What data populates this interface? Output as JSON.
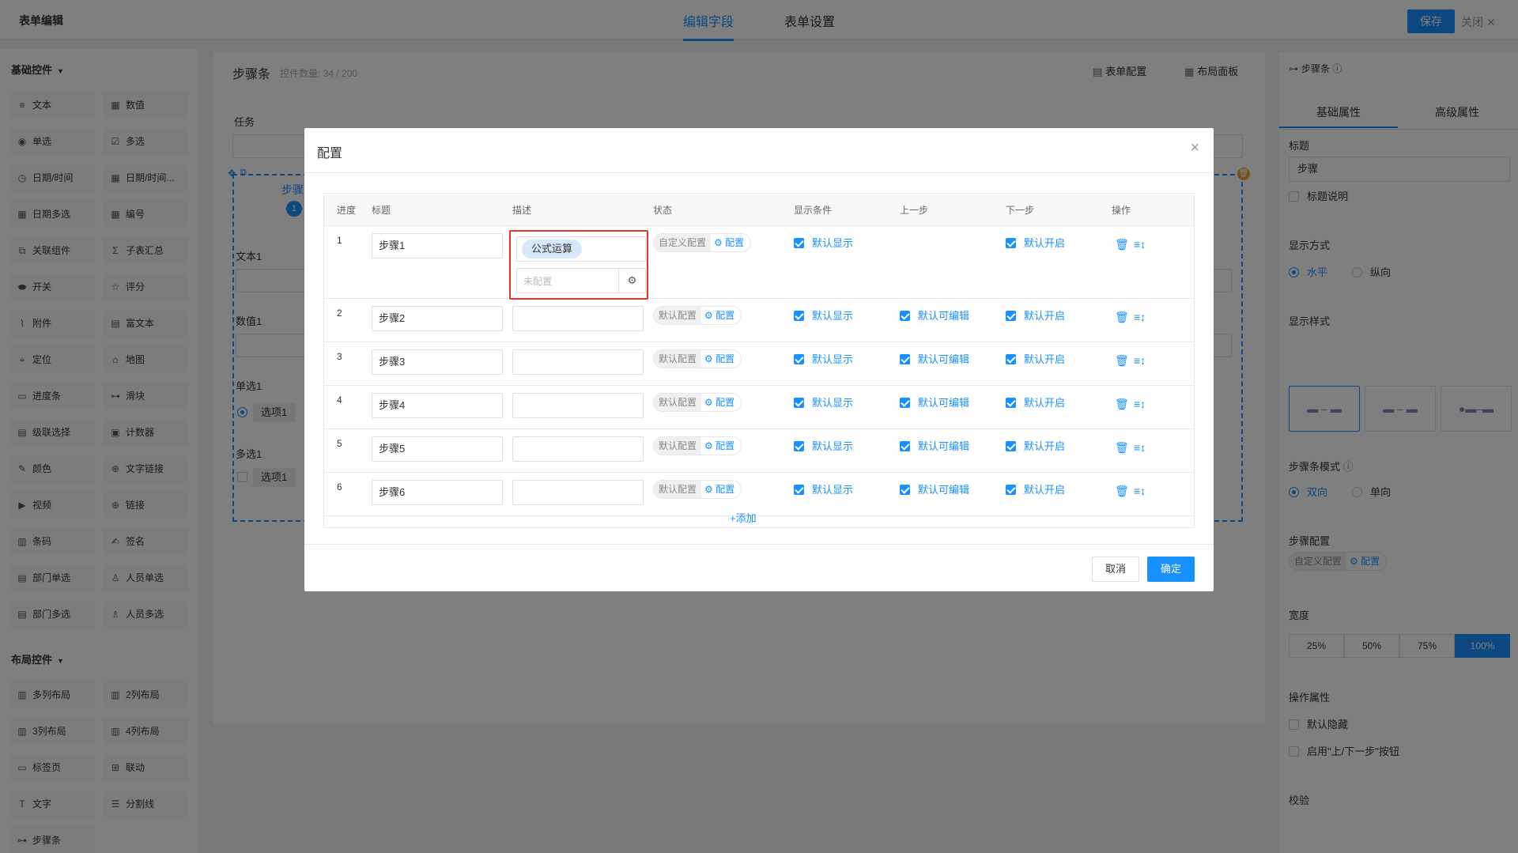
{
  "header": {
    "app_title": "表单编辑",
    "tabs": [
      {
        "label": "编辑字段"
      },
      {
        "label": "表单设置"
      }
    ],
    "save_label": "保存",
    "close_label": "关闭"
  },
  "left_panel": {
    "basic_title": "基础控件",
    "basic_items": [
      {
        "label": "文本",
        "icon": "text-icon"
      },
      {
        "label": "数值",
        "icon": "number-icon"
      },
      {
        "label": "单选",
        "icon": "radio-icon"
      },
      {
        "label": "多选",
        "icon": "checkbox-icon"
      },
      {
        "label": "日期/时间",
        "icon": "clock-icon"
      },
      {
        "label": "日期/时间...",
        "icon": "calendar-icon"
      },
      {
        "label": "日期多选",
        "icon": "calendar-icon"
      },
      {
        "label": "编号",
        "icon": "number-icon"
      },
      {
        "label": "关联组件",
        "icon": "link-icon"
      },
      {
        "label": "子表汇总",
        "icon": "sigma-icon"
      },
      {
        "label": "开关",
        "icon": "toggle-icon"
      },
      {
        "label": "评分",
        "icon": "star-icon"
      },
      {
        "label": "附件",
        "icon": "paperclip-icon"
      },
      {
        "label": "富文本",
        "icon": "richtext-icon"
      },
      {
        "label": "定位",
        "icon": "location-icon"
      },
      {
        "label": "地图",
        "icon": "map-icon"
      },
      {
        "label": "进度条",
        "icon": "progress-icon"
      },
      {
        "label": "滑块",
        "icon": "slider-icon"
      },
      {
        "label": "级联选择",
        "icon": "cascade-icon"
      },
      {
        "label": "计数器",
        "icon": "counter-icon"
      },
      {
        "label": "颜色",
        "icon": "color-icon"
      },
      {
        "label": "文字链接",
        "icon": "globe-icon"
      },
      {
        "label": "视频",
        "icon": "video-icon"
      },
      {
        "label": "链接",
        "icon": "globe-icon"
      },
      {
        "label": "条码",
        "icon": "barcode-icon"
      },
      {
        "label": "签名",
        "icon": "signature-icon"
      },
      {
        "label": "部门单选",
        "icon": "department-icon"
      },
      {
        "label": "人员单选",
        "icon": "user-icon"
      },
      {
        "label": "部门多选",
        "icon": "department-icon"
      },
      {
        "label": "人员多选",
        "icon": "users-icon"
      }
    ],
    "layout_title": "布局控件",
    "layout_items": [
      {
        "label": "多列布局",
        "icon": "columns-icon"
      },
      {
        "label": "2列布局",
        "icon": "columns-icon"
      },
      {
        "label": "3列布局",
        "icon": "columns-icon"
      },
      {
        "label": "4列布局",
        "icon": "columns-icon"
      },
      {
        "label": "标签页",
        "icon": "tabs-icon"
      },
      {
        "label": "联动",
        "icon": "linkage-icon"
      },
      {
        "label": "文字",
        "icon": "text-t-icon"
      },
      {
        "label": "分割线",
        "icon": "divider-icon"
      },
      {
        "label": "步骤条",
        "icon": "steps-icon"
      }
    ]
  },
  "canvas": {
    "title": "步骤条",
    "count": "控件数量: 34 / 200",
    "form_config": "表单配置",
    "layout_panel": "布局面板",
    "field_task": "任务",
    "field_step_partial": "步骤",
    "step_number": "1",
    "field_text1": "文本1",
    "field_num1": "数值1",
    "field_radio1": "单选1",
    "radio_option": "选项1",
    "field_checkbox1": "多选1",
    "checkbox_option": "选项1"
  },
  "right_panel": {
    "header": "步骤条",
    "tabs": [
      {
        "label": "基础属性"
      },
      {
        "label": "高级属性"
      }
    ],
    "title_label": "标题",
    "title_value": "步骤",
    "title_desc": "标题说明",
    "display_mode_label": "显示方式",
    "display_mode_options": [
      "水平",
      "纵向"
    ],
    "display_style_label": "显示样式",
    "mode_label": "步骤条模式",
    "mode_options": [
      "双向",
      "单向"
    ],
    "step_config_label": "步骤配置",
    "step_config_state": "自定义配置",
    "step_config_btn": "配置",
    "width_label": "宽度",
    "width_options": [
      "25%",
      "50%",
      "75%",
      "100%"
    ],
    "op_label": "操作属性",
    "op_hidden": "默认隐藏",
    "op_nav": "启用\"上/下一步\"按钮",
    "validate_label": "校验"
  },
  "modal": {
    "title": "配置",
    "columns": [
      "进度",
      "标题",
      "描述",
      "状态",
      "显示条件",
      "上一步",
      "下一步",
      "操作"
    ],
    "rows": [
      {
        "num": "1",
        "title": "步骤1",
        "state": "自定义配置",
        "show": "默认显示",
        "prev": "",
        "next": "默认开启"
      },
      {
        "num": "2",
        "title": "步骤2",
        "state": "默认配置",
        "show": "默认显示",
        "prev": "默认可编辑",
        "next": "默认开启"
      },
      {
        "num": "3",
        "title": "步骤3",
        "state": "默认配置",
        "show": "默认显示",
        "prev": "默认可编辑",
        "next": "默认开启"
      },
      {
        "num": "4",
        "title": "步骤4",
        "state": "默认配置",
        "show": "默认显示",
        "prev": "默认可编辑",
        "next": "默认开启"
      },
      {
        "num": "5",
        "title": "步骤5",
        "state": "默认配置",
        "show": "默认显示",
        "prev": "默认可编辑",
        "next": "默认开启"
      },
      {
        "num": "6",
        "title": "步骤6",
        "state": "默认配置",
        "show": "默认显示",
        "prev": "默认可编辑",
        "next": "默认开启"
      }
    ],
    "config_btn": "配置",
    "formula_tag": "公式运算",
    "unconfigured": "未配置",
    "add_label": "+添加",
    "cancel_label": "取消",
    "ok_label": "确定"
  },
  "colors": {
    "accent": "#1890ff",
    "highlight": "#e5332a"
  }
}
